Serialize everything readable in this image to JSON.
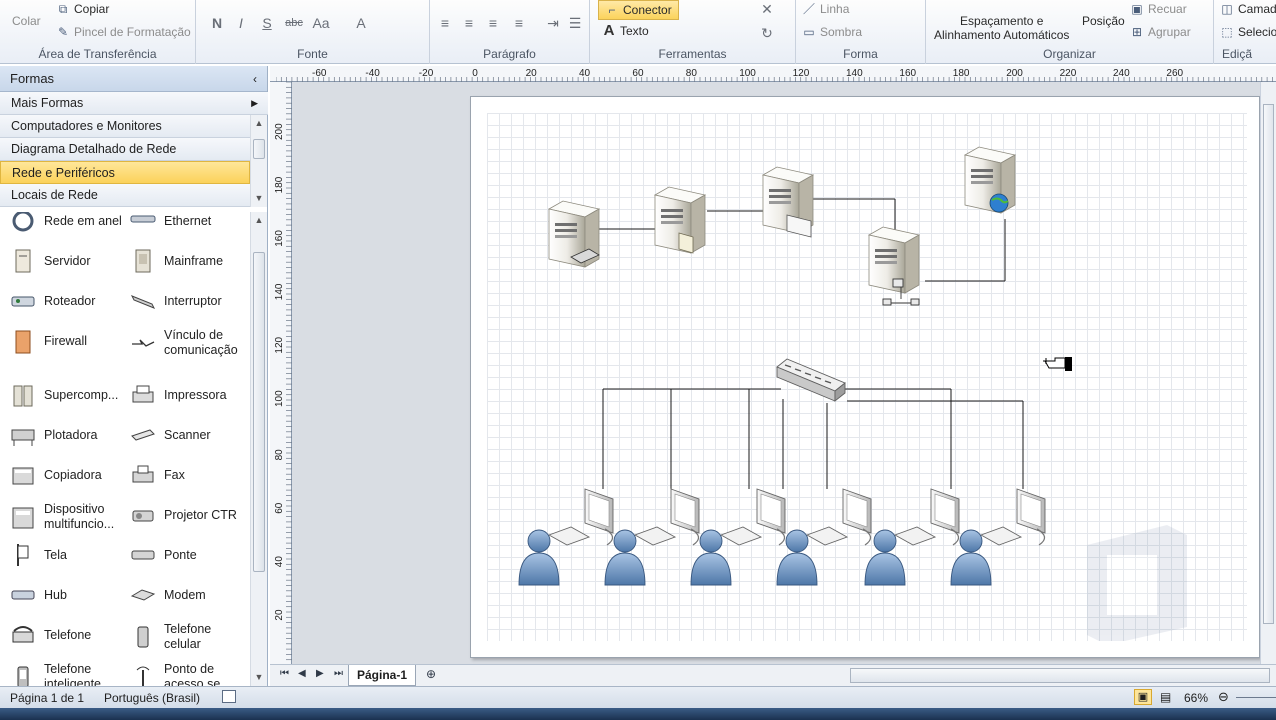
{
  "ribbon": {
    "clipboard": {
      "paste": "Colar",
      "copy": "Copiar",
      "format_painter": "Pincel de Formatação",
      "label": "Área de Transferência"
    },
    "font": {
      "label": "Fonte",
      "bold": "N",
      "italic": "I",
      "underline": "S",
      "strike": "abc",
      "case": "Aa",
      "color": "A"
    },
    "paragraph": {
      "label": "Parágrafo"
    },
    "tools": {
      "connector": "Conector",
      "text": "Texto",
      "label": "Ferramentas"
    },
    "shape": {
      "line": "Linha",
      "shadow": "Sombra",
      "label": "Forma"
    },
    "arrange": {
      "spacing_l1": "Espaçamento e",
      "spacing_l2": "Alinhamento Automáticos",
      "position": "Posição",
      "send_back": "Recuar",
      "group": "Agrupar",
      "label": "Organizar"
    },
    "layers": "Camad",
    "select": "Selecio",
    "edit_label": "Ediçã"
  },
  "shapes_panel": {
    "title": "Formas",
    "categories": [
      {
        "label": "Mais Formas"
      },
      {
        "label": "Computadores e Monitores"
      },
      {
        "label": "Diagrama Detalhado de Rede"
      },
      {
        "label": "Rede e Periféricos"
      },
      {
        "label": "Locais de Rede"
      }
    ],
    "items": [
      {
        "label": "Rede em anel",
        "icon": "ring-network-icon"
      },
      {
        "label": "Ethernet",
        "icon": "ethernet-icon"
      },
      {
        "label": "Servidor",
        "icon": "server-icon"
      },
      {
        "label": "Mainframe",
        "icon": "mainframe-icon"
      },
      {
        "label": "Roteador",
        "icon": "router-icon"
      },
      {
        "label": "Interruptor",
        "icon": "switch-icon"
      },
      {
        "label": "Firewall",
        "icon": "firewall-icon"
      },
      {
        "label": "Vínculo de comunicação",
        "icon": "comm-link-icon"
      },
      {
        "label": "Supercomp...",
        "icon": "supercomputer-icon"
      },
      {
        "label": "Impressora",
        "icon": "printer-icon"
      },
      {
        "label": "Plotadora",
        "icon": "plotter-icon"
      },
      {
        "label": "Scanner",
        "icon": "scanner-icon"
      },
      {
        "label": "Copiadora",
        "icon": "copier-icon"
      },
      {
        "label": "Fax",
        "icon": "fax-icon"
      },
      {
        "label": "Dispositivo multifuncio...",
        "icon": "multifunction-icon"
      },
      {
        "label": "Projetor CTR",
        "icon": "projector-icon"
      },
      {
        "label": "Tela",
        "icon": "screen-icon"
      },
      {
        "label": "Ponte",
        "icon": "bridge-icon"
      },
      {
        "label": "Hub",
        "icon": "hub-icon"
      },
      {
        "label": "Modem",
        "icon": "modem-icon"
      },
      {
        "label": "Telefone",
        "icon": "telephone-icon"
      },
      {
        "label": "Telefone celular",
        "icon": "cell-phone-icon"
      },
      {
        "label": "Telefone inteligente",
        "icon": "smartphone-icon"
      },
      {
        "label": "Ponto de acesso se...",
        "icon": "access-point-icon"
      }
    ]
  },
  "ruler": {
    "top_ticks": [
      "-60",
      "-40",
      "-20",
      "0",
      "20",
      "40",
      "60",
      "80",
      "100",
      "120",
      "140",
      "160",
      "180",
      "200",
      "220",
      "240",
      "260"
    ],
    "left_ticks": [
      "200",
      "180",
      "160",
      "140",
      "120",
      "100",
      "80",
      "60",
      "40",
      "20"
    ]
  },
  "page_tabs": {
    "active": "Página-1"
  },
  "status": {
    "page": "Página 1 de 1",
    "language": "Português (Brasil)",
    "zoom": "66%"
  },
  "colors": {
    "selected_category": "#fbd25a",
    "ribbon_bg": "#e9eef6"
  }
}
